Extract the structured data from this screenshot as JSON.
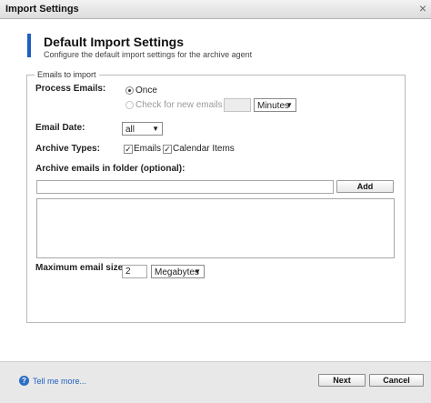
{
  "window": {
    "title": "Import Settings",
    "close_glyph": "×"
  },
  "header": {
    "title": "Default Import Settings",
    "subtitle": "Configure the default import settings for the archive agent"
  },
  "section": {
    "legend": "Emails to import"
  },
  "process_emails": {
    "label": "Process Emails:",
    "once_label": "Once",
    "check_label": "Check for new emails every",
    "interval_value": "",
    "interval_unit": "Minutes",
    "selected": "once"
  },
  "email_date": {
    "label": "Email Date:",
    "value": "all"
  },
  "archive_types": {
    "label": "Archive Types:",
    "emails_label": "Emails",
    "calendar_label": "Calendar Items",
    "check_glyph": "✓"
  },
  "folder": {
    "label": "Archive emails in folder (optional):",
    "input_value": "",
    "add_label": "Add"
  },
  "max_size": {
    "label": "Maximum email size:",
    "value": "2",
    "unit": "Megabytes"
  },
  "footer": {
    "help_icon": "?",
    "help_text": "Tell me more...",
    "next_label": "Next",
    "cancel_label": "Cancel"
  },
  "icons": {
    "dropdown": "▼"
  }
}
